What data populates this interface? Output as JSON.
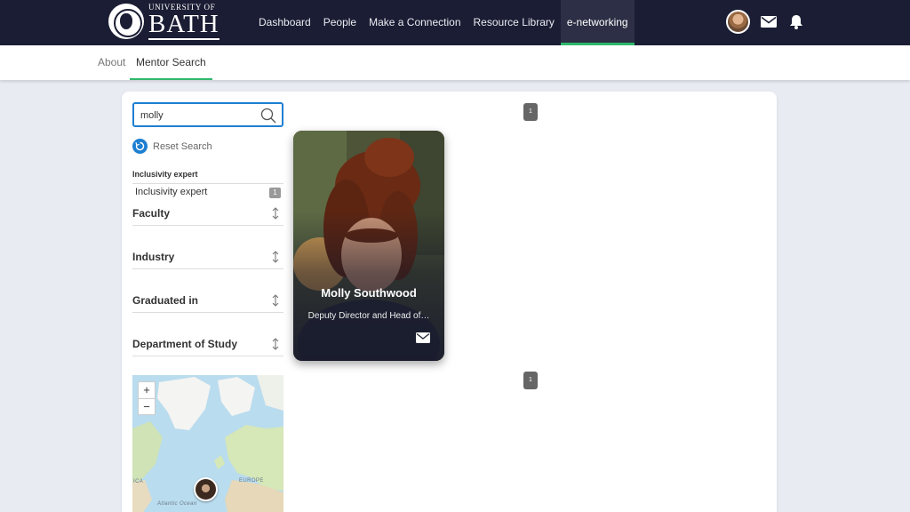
{
  "header": {
    "logo_small": "UNIVERSITY OF",
    "logo_big": "BATH",
    "nav": [
      {
        "label": "Dashboard"
      },
      {
        "label": "People"
      },
      {
        "label": "Make a Connection"
      },
      {
        "label": "Resource Library"
      },
      {
        "label": "e-networking",
        "active": true
      }
    ],
    "icons": [
      "user-avatar",
      "envelope-icon",
      "bell-icon"
    ]
  },
  "subnav": {
    "tabs": [
      {
        "label": "About"
      },
      {
        "label": "Mentor Search",
        "active": true
      }
    ]
  },
  "search": {
    "value": "molly",
    "placeholder": "",
    "reset_label": "Reset Search"
  },
  "facets": {
    "active_title": "Inclusivity expert",
    "active_option": {
      "label": "Inclusivity expert",
      "count": "1"
    },
    "filters": [
      {
        "label": "Faculty"
      },
      {
        "label": "Industry"
      },
      {
        "label": "Graduated in"
      },
      {
        "label": "Department of Study"
      }
    ]
  },
  "map": {
    "zoom_in": "+",
    "zoom_out": "−",
    "labels": [
      "EUROPE",
      "ICA",
      "Atlantic Ocean"
    ]
  },
  "pagination": {
    "top": "1",
    "bottom": "1"
  },
  "results": [
    {
      "name": "Molly Southwood",
      "role": "Deputy Director and Head of…"
    }
  ],
  "colors": {
    "header_bg": "#1a1d33",
    "active_tab_accent": "#2fb86b",
    "focus_blue": "#1e7fd1"
  }
}
